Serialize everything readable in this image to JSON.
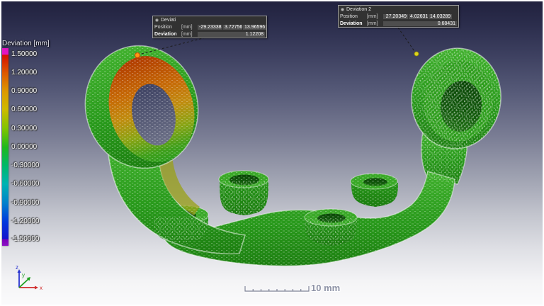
{
  "legend": {
    "title": "Deviation [mm]",
    "ticks": [
      "1.50000",
      "1.20000",
      "0.90000",
      "0.60000",
      "0.30000",
      "0.00000",
      "-0.30000",
      "-0.60000",
      "-0.90000",
      "-1.20000",
      "-1.50000"
    ]
  },
  "annotations": {
    "a1": {
      "title": "Deviati",
      "position_label": "Position",
      "unit": "[mm]",
      "x": "-29.23338",
      "y": "3.72756",
      "z": "13.96596",
      "deviation_label": "Deviation",
      "deviation_value": "1.12208"
    },
    "a2": {
      "title": "Deviation 2",
      "position_label": "Position",
      "unit": "[mm]",
      "x": "27.20349",
      "y": "4.02631",
      "z": "14.03289",
      "deviation_label": "Deviation",
      "deviation_value": "0.68431"
    }
  },
  "scale_bar": {
    "label": "10 mm"
  },
  "axes": {
    "x": "x",
    "y": "y",
    "z": "z"
  }
}
